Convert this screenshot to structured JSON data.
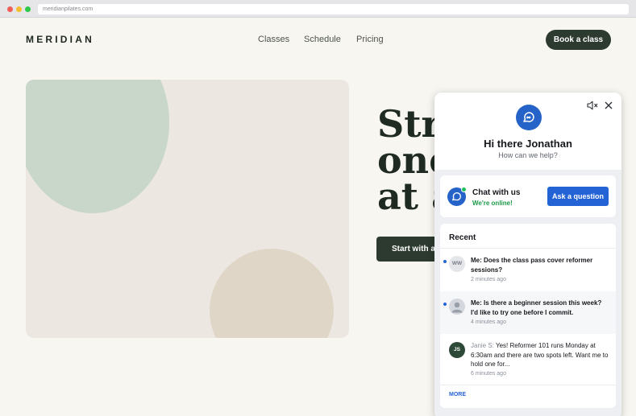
{
  "browser": {
    "url": "meridianpilates.com"
  },
  "site": {
    "logo": "MERIDIAN",
    "nav": [
      "Classes",
      "Schedule",
      "Pricing"
    ],
    "book_label": "Book a class",
    "headline_lines": [
      "Stre",
      "one",
      "at a"
    ],
    "start_label": "Start with a"
  },
  "widget": {
    "greeting": "Hi there Jonathan",
    "subtitle": "How can we help?",
    "chat_title": "Chat with us",
    "chat_status": "We're online!",
    "ask_label": "Ask a question",
    "recent_title": "Recent",
    "conversations": [
      {
        "initials": "WW",
        "text": "Me: Does the class pass cover reformer sessions?",
        "time": "2 minutes ago"
      },
      {
        "initials": "",
        "text": "Me: Is there a beginner session this week? I'd like to try one before I commit.",
        "time": "4 minutes ago"
      },
      {
        "initials": "JS",
        "author": "Janie S:",
        "text": "Yes! Reformer 101 runs Monday at 6:30am and there are two spots left. Want me to hold one for...",
        "time": "6 minutes ago"
      }
    ],
    "more_label": "MORE"
  },
  "colors": {
    "brand_dark": "#2d3a30",
    "accent_blue": "#2463d6",
    "online_green": "#1c9a48"
  }
}
